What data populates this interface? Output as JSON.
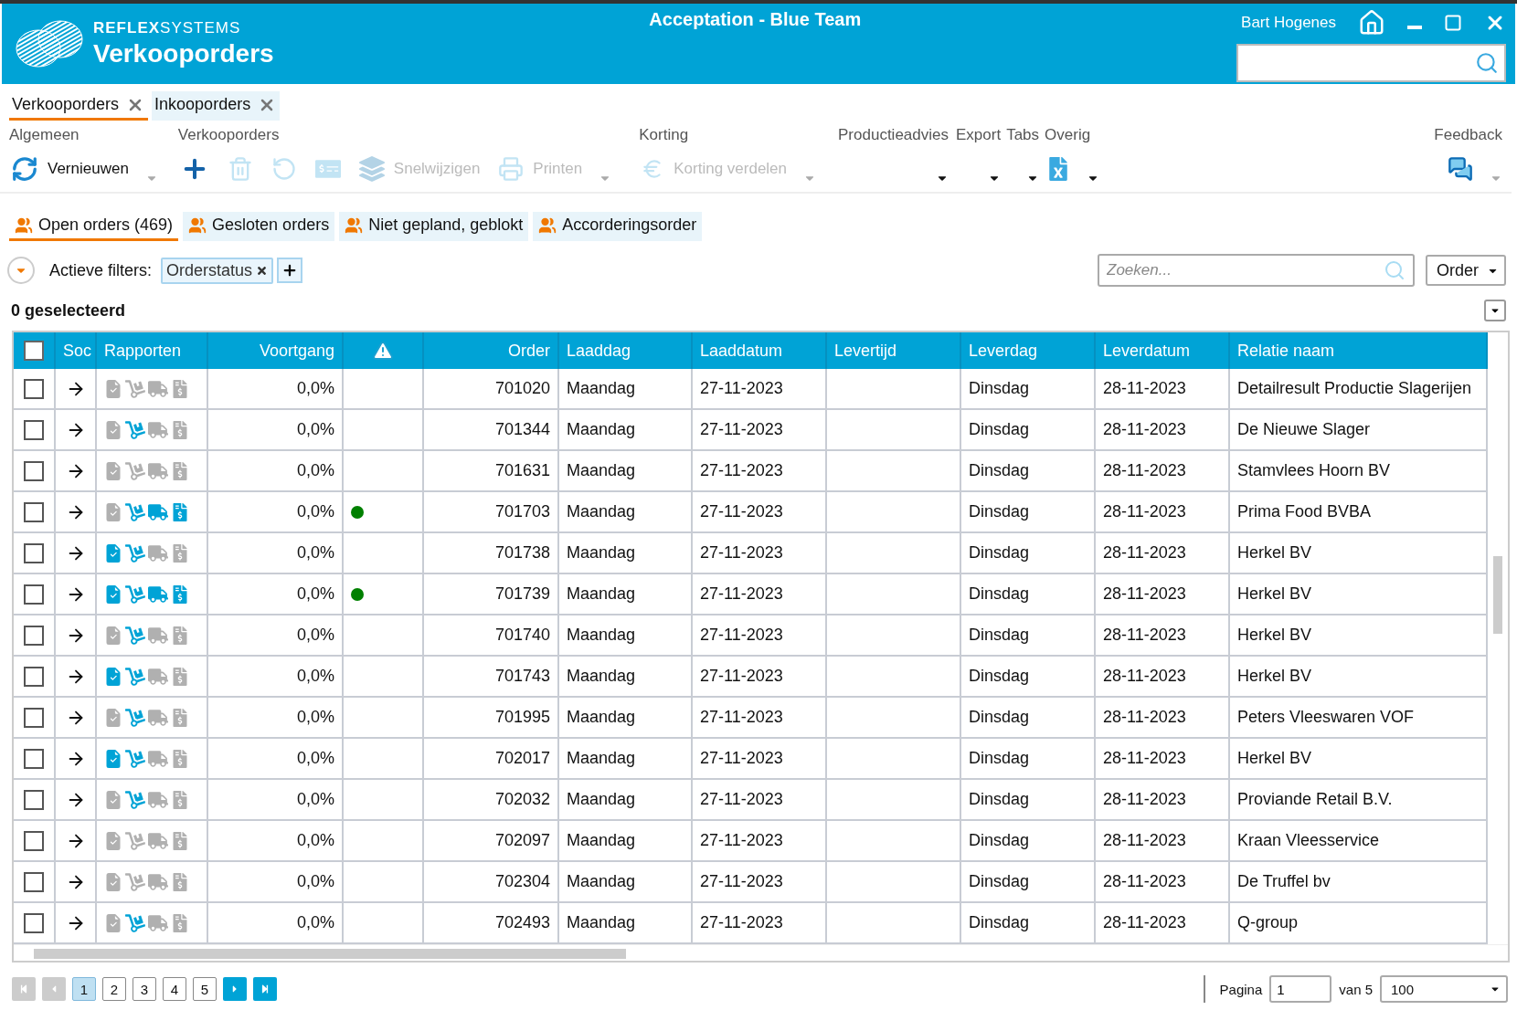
{
  "header": {
    "brand": "**REFLEX**SYSTEMS",
    "module": "Verkooporders",
    "title": "Acceptation - Blue Team",
    "user": "Bart Hogenes"
  },
  "doc_tabs": [
    {
      "label": "Verkooporders",
      "selected": true
    },
    {
      "label": "Inkooporders",
      "selected": false
    }
  ],
  "toolbar": [
    {
      "label": "Algemeen",
      "items": [
        {
          "label": "Vernieuwen",
          "disabled": false
        }
      ]
    },
    {
      "label": "Verkooporders",
      "items": [
        {
          "disabled": false
        },
        {
          "disabled": true
        },
        {
          "disabled": true
        },
        {
          "disabled": true
        },
        {
          "label": "Snelwijzigen",
          "disabled": true
        },
        {
          "label": "Printen",
          "disabled": true
        }
      ]
    },
    {
      "label": "Korting",
      "items": [
        {
          "label": "Korting verdelen",
          "disabled": true
        }
      ]
    },
    {
      "label": "Productieadvies"
    },
    {
      "label": "Export"
    },
    {
      "label": "Tabs"
    },
    {
      "label": "Overig",
      "items": [
        {
          "disabled": false
        }
      ]
    },
    {
      "label": "Feedback",
      "items": [
        {
          "disabled": false
        }
      ]
    }
  ],
  "view_tabs": [
    {
      "label": "Open orders (469)",
      "selected": true
    },
    {
      "label": "Gesloten orders",
      "selected": false
    },
    {
      "label": "Niet gepland, geblokt",
      "selected": false
    },
    {
      "label": "Accorderingsorder",
      "selected": false
    }
  ],
  "filters": {
    "label": "Actieve filters:",
    "chips": [
      "Orderstatus"
    ],
    "search": {
      "placeholder": "Zoeken..."
    },
    "field": "Order"
  },
  "selection": "0 geselecteerd",
  "table": {
    "all_selected": false,
    "columns": [
      "Soc",
      "Rapporten",
      "Voortgang",
      "Order",
      "Laaddag",
      "Laaddatum",
      "Levertijd",
      "Leverdag",
      "Leverdatum",
      "Relatie naam"
    ],
    "rows": [
      {
        "checked": false,
        "reports": [
          false,
          false,
          false,
          false
        ],
        "alert": false,
        "progress": "0,0%",
        "order": "701020",
        "laaddag": "Maandag",
        "laaddatum": "27-11-2023",
        "leverdag": "Dinsdag",
        "leverdatum": "28-11-2023",
        "relatie": "Detailresult Productie Slagerijen"
      },
      {
        "checked": false,
        "reports": [
          false,
          true,
          false,
          false
        ],
        "alert": false,
        "progress": "0,0%",
        "order": "701344",
        "laaddag": "Maandag",
        "laaddatum": "27-11-2023",
        "leverdag": "Dinsdag",
        "leverdatum": "28-11-2023",
        "relatie": "De Nieuwe Slager"
      },
      {
        "checked": false,
        "reports": [
          false,
          false,
          false,
          false
        ],
        "alert": false,
        "progress": "0,0%",
        "order": "701631",
        "laaddag": "Maandag",
        "laaddatum": "27-11-2023",
        "leverdag": "Dinsdag",
        "leverdatum": "28-11-2023",
        "relatie": "Stamvlees Hoorn BV"
      },
      {
        "checked": false,
        "reports": [
          false,
          true,
          true,
          true
        ],
        "alert": true,
        "progress": "0,0%",
        "order": "701703",
        "laaddag": "Maandag",
        "laaddatum": "27-11-2023",
        "leverdag": "Dinsdag",
        "leverdatum": "28-11-2023",
        "relatie": "Prima Food BVBA"
      },
      {
        "checked": false,
        "reports": [
          true,
          true,
          false,
          false
        ],
        "alert": false,
        "progress": "0,0%",
        "order": "701738",
        "laaddag": "Maandag",
        "laaddatum": "27-11-2023",
        "leverdag": "Dinsdag",
        "leverdatum": "28-11-2023",
        "relatie": "Herkel BV"
      },
      {
        "checked": false,
        "reports": [
          true,
          true,
          true,
          true
        ],
        "alert": true,
        "progress": "0,0%",
        "order": "701739",
        "laaddag": "Maandag",
        "laaddatum": "27-11-2023",
        "leverdag": "Dinsdag",
        "leverdatum": "28-11-2023",
        "relatie": "Herkel BV"
      },
      {
        "checked": false,
        "reports": [
          false,
          true,
          false,
          false
        ],
        "alert": false,
        "progress": "0,0%",
        "order": "701740",
        "laaddag": "Maandag",
        "laaddatum": "27-11-2023",
        "leverdag": "Dinsdag",
        "leverdatum": "28-11-2023",
        "relatie": "Herkel BV"
      },
      {
        "checked": false,
        "reports": [
          true,
          true,
          false,
          false
        ],
        "alert": false,
        "progress": "0,0%",
        "order": "701743",
        "laaddag": "Maandag",
        "laaddatum": "27-11-2023",
        "leverdag": "Dinsdag",
        "leverdatum": "28-11-2023",
        "relatie": "Herkel BV"
      },
      {
        "checked": false,
        "reports": [
          false,
          true,
          false,
          false
        ],
        "alert": false,
        "progress": "0,0%",
        "order": "701995",
        "laaddag": "Maandag",
        "laaddatum": "27-11-2023",
        "leverdag": "Dinsdag",
        "leverdatum": "28-11-2023",
        "relatie": "Peters Vleeswaren VOF"
      },
      {
        "checked": false,
        "reports": [
          true,
          true,
          false,
          false
        ],
        "alert": false,
        "progress": "0,0%",
        "order": "702017",
        "laaddag": "Maandag",
        "laaddatum": "27-11-2023",
        "leverdag": "Dinsdag",
        "leverdatum": "28-11-2023",
        "relatie": "Herkel BV"
      },
      {
        "checked": false,
        "reports": [
          false,
          true,
          false,
          false
        ],
        "alert": false,
        "progress": "0,0%",
        "order": "702032",
        "laaddag": "Maandag",
        "laaddatum": "27-11-2023",
        "leverdag": "Dinsdag",
        "leverdatum": "28-11-2023",
        "relatie": "Proviande Retail B.V."
      },
      {
        "checked": false,
        "reports": [
          false,
          false,
          false,
          false
        ],
        "alert": false,
        "progress": "0,0%",
        "order": "702097",
        "laaddag": "Maandag",
        "laaddatum": "27-11-2023",
        "leverdag": "Dinsdag",
        "leverdatum": "28-11-2023",
        "relatie": "Kraan Vleesservice"
      },
      {
        "checked": false,
        "reports": [
          false,
          false,
          false,
          false
        ],
        "alert": false,
        "progress": "0,0%",
        "order": "702304",
        "laaddag": "Maandag",
        "laaddatum": "27-11-2023",
        "leverdag": "Dinsdag",
        "leverdatum": "28-11-2023",
        "relatie": "De Truffel bv"
      },
      {
        "checked": false,
        "reports": [
          false,
          true,
          false,
          false
        ],
        "alert": false,
        "progress": "0,0%",
        "order": "702493",
        "laaddag": "Maandag",
        "laaddatum": "27-11-2023",
        "leverdag": "Dinsdag",
        "leverdatum": "28-11-2023",
        "relatie": "Q-group"
      }
    ]
  },
  "pagination": {
    "pages": [
      {
        "label": "1",
        "selected": true
      },
      {
        "label": "2",
        "selected": false
      },
      {
        "label": "3",
        "selected": false
      },
      {
        "label": "4",
        "selected": false
      },
      {
        "label": "5",
        "selected": false
      }
    ],
    "first_disabled": true,
    "last_disabled": false,
    "page_label": "Pagina",
    "page": "1",
    "of": "van 5",
    "page_size": "100"
  }
}
